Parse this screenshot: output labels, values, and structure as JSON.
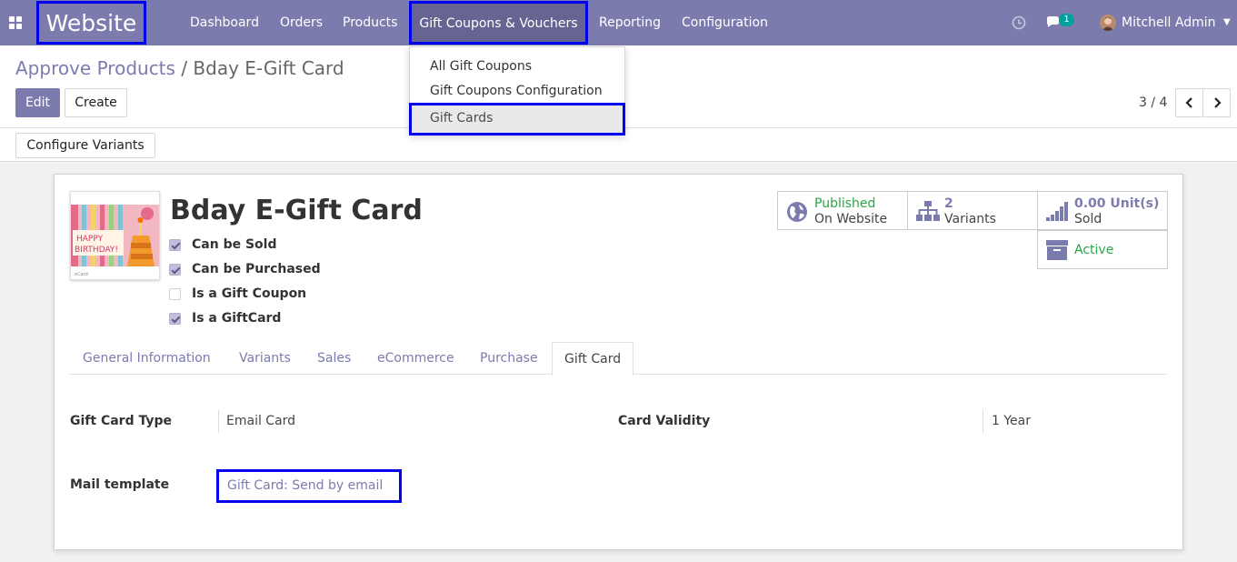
{
  "navbar": {
    "brand": "Website",
    "menu": [
      "Dashboard",
      "Orders",
      "Products",
      "Gift Coupons & Vouchers",
      "Reporting",
      "Configuration"
    ],
    "chat_badge": "1",
    "user": "Mitchell Admin",
    "background_color": "#7c7bad",
    "highlight_color": "#0000ee"
  },
  "dropdown": {
    "items": [
      "All Gift Coupons",
      "Gift Coupons Configuration",
      "Gift Cards"
    ]
  },
  "breadcrumb": {
    "parent": "Approve Products",
    "separator": "/",
    "current": "Bday E-Gift Card"
  },
  "buttons": {
    "edit": "Edit",
    "create": "Create",
    "configure_variants": "Configure Variants"
  },
  "pager": {
    "value": "3 / 4"
  },
  "product": {
    "name": "Bday E-Gift Card",
    "image_text": "HAPPY BIRTHDAY!",
    "checkboxes": [
      {
        "label": "Can be Sold",
        "checked": true
      },
      {
        "label": "Can be Purchased",
        "checked": true
      },
      {
        "label": "Is a Gift Coupon",
        "checked": false
      },
      {
        "label": "Is a GiftCard",
        "checked": true
      }
    ]
  },
  "stats": {
    "published_top": "Published",
    "published_bottom": "On Website",
    "variants_count": "2",
    "variants_label": "Variants",
    "sold_value": "0.00",
    "sold_unit": "Unit(s)",
    "sold_label": "Sold",
    "active_label": "Active"
  },
  "tabs": [
    "General Information",
    "Variants",
    "Sales",
    "eCommerce",
    "Purchase",
    "Gift Card"
  ],
  "gift_card": {
    "type_label": "Gift Card Type",
    "type_value": "Email Card",
    "validity_label": "Card Validity",
    "validity_value": "1 Year",
    "mail_label": "Mail template",
    "mail_value": "Gift Card: Send by email"
  }
}
